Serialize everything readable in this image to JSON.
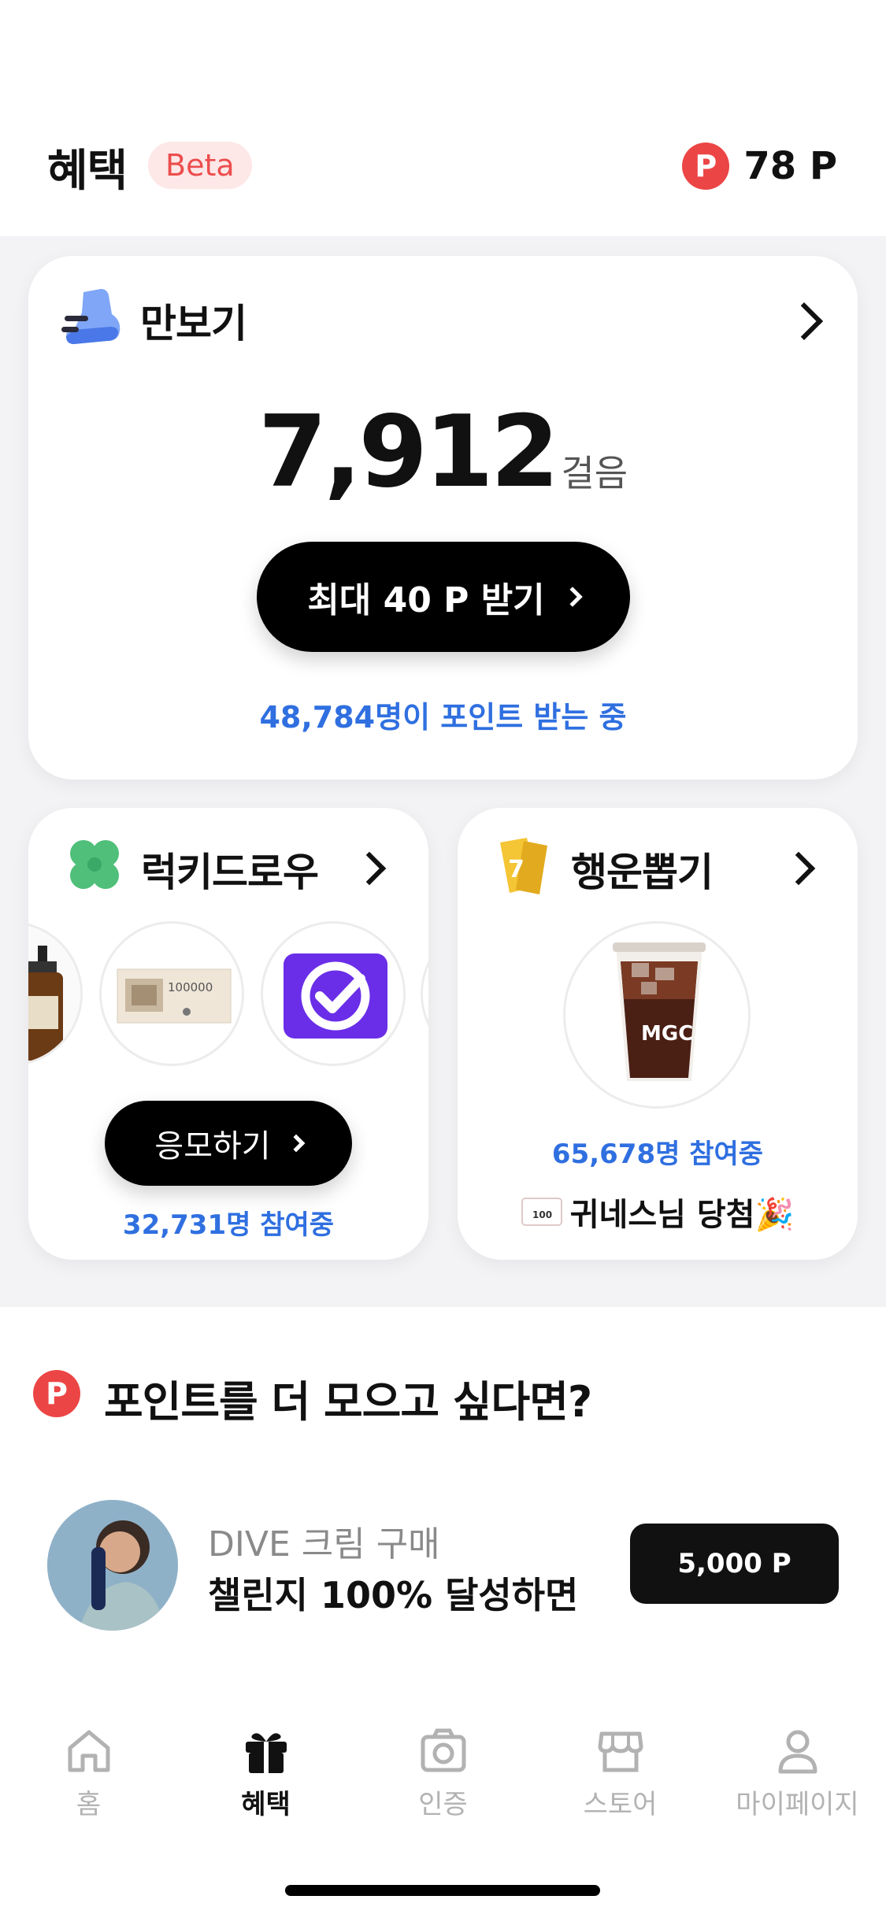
{
  "header": {
    "title": "혜택",
    "badge": "Beta",
    "points_symbol": "P",
    "points_value": "78 P"
  },
  "pedometer": {
    "title": "만보기",
    "steps": "7,912",
    "steps_unit": "걸음",
    "button_label": "최대 40 P 받기",
    "participants": "48,784명이 포인트 받는 중"
  },
  "lucky_draw": {
    "title": "럭키드로우",
    "button_label": "응모하기",
    "participants": "32,731명 참여중",
    "prizes": [
      "aesop-hand-wash",
      "100000-won-gift-voucher",
      "checkmark-app"
    ],
    "voucher_amount": "100000"
  },
  "fortune_draw": {
    "title": "행운뽑기",
    "participants": "65,678명 참여중",
    "winner_text": "귀네스님 당첨🎉",
    "coupon_value": "100",
    "cup_brand": "MGC"
  },
  "more_points": {
    "symbol": "P",
    "title": "포인트를 더 모으고 싶다면?",
    "challenge": {
      "line1": "DIVE 크림 구매",
      "line2": "챌린지 100% 달성하면",
      "reward": "5,000 P"
    }
  },
  "tabbar": {
    "tabs": [
      {
        "label": "홈",
        "icon": "home-icon",
        "active": false
      },
      {
        "label": "혜택",
        "icon": "gift-icon",
        "active": true
      },
      {
        "label": "인증",
        "icon": "camera-icon",
        "active": false
      },
      {
        "label": "스토어",
        "icon": "store-icon",
        "active": false
      },
      {
        "label": "마이페이지",
        "icon": "person-icon",
        "active": false
      }
    ]
  },
  "colors": {
    "brand_red": "#ec4545",
    "link_blue": "#2f6fe0",
    "badge_bg": "#fde7e7"
  }
}
